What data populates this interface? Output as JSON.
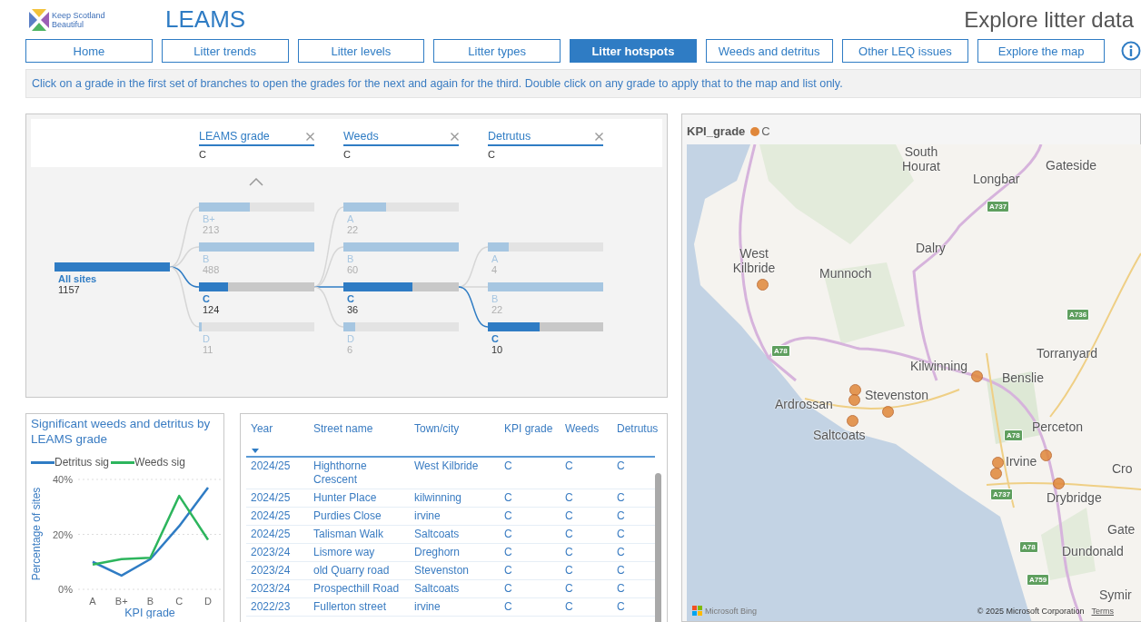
{
  "header": {
    "logo_text": "Keep Scotland Beautiful",
    "app_title": "LEAMS",
    "page_title": "Explore litter data"
  },
  "nav": [
    {
      "label": "Home",
      "selected": false
    },
    {
      "label": "Litter trends",
      "selected": false
    },
    {
      "label": "Litter levels",
      "selected": false
    },
    {
      "label": "Litter types",
      "selected": false
    },
    {
      "label": "Litter hotspots",
      "selected": true
    },
    {
      "label": "Weeds and detritus",
      "selected": false
    },
    {
      "label": "Other LEQ issues",
      "selected": false
    },
    {
      "label": "Explore the map",
      "selected": false
    }
  ],
  "instruction": "Click on a grade in the first set of branches to open the grades for the next and again for the third. Double click on any grade to apply that to the map and list only.",
  "decomposition_tree": {
    "filters": [
      {
        "label": "LEAMS grade",
        "value": "C"
      },
      {
        "label": "Weeds",
        "value": "C"
      },
      {
        "label": "Detrutus",
        "value": "C"
      }
    ],
    "root": {
      "label": "All sites",
      "count": "1157",
      "level": 1,
      "selected": true,
      "children": [
        {
          "label": "B+",
          "count": "213",
          "level": 0.44,
          "selected": false
        },
        {
          "label": "B",
          "count": "488",
          "level": 1,
          "selected": false
        },
        {
          "label": "C",
          "count": "124",
          "level": 0.25,
          "selected": true,
          "children": [
            {
              "label": "A",
              "count": "22",
              "level": 0.37,
              "selected": false
            },
            {
              "label": "B",
              "count": "60",
              "level": 1,
              "selected": false
            },
            {
              "label": "C",
              "count": "36",
              "level": 0.6,
              "selected": true,
              "children": [
                {
                  "label": "A",
                  "count": "4",
                  "level": 0.18,
                  "selected": false
                },
                {
                  "label": "B",
                  "count": "22",
                  "level": 1,
                  "selected": false
                },
                {
                  "label": "C",
                  "count": "10",
                  "level": 0.45,
                  "selected": true
                }
              ]
            },
            {
              "label": "D",
              "count": "6",
              "level": 0.1,
              "selected": false
            }
          ]
        },
        {
          "label": "D",
          "count": "11",
          "level": 0.02,
          "selected": false
        }
      ]
    }
  },
  "chart": {
    "title": "Significant weeds and detritus by LEAMS grade",
    "chart_data": {
      "type": "line",
      "xlabel": "KPI grade",
      "ylabel": "Percentage of sites",
      "categories": [
        "A",
        "B+",
        "B",
        "C",
        "D"
      ],
      "series": [
        {
          "name": "Detritus sig",
          "color": "#2f7cc4",
          "values": [
            10,
            5,
            11,
            23,
            37
          ]
        },
        {
          "name": "Weeds sig",
          "color": "#2db55d",
          "values": [
            9,
            11,
            11.5,
            34,
            18
          ]
        }
      ],
      "ylim": [
        0,
        40
      ],
      "yticks": [
        {
          "value": 0,
          "label": "0%"
        },
        {
          "value": 20,
          "label": "20%"
        },
        {
          "value": 40,
          "label": "40%"
        }
      ]
    }
  },
  "table": {
    "columns": [
      {
        "label": "Year",
        "sorted": true
      },
      {
        "label": "Street name",
        "sorted": false
      },
      {
        "label": "Town/city",
        "sorted": false
      },
      {
        "label": "KPI grade",
        "sorted": false
      },
      {
        "label": "Weeds",
        "sorted": false
      },
      {
        "label": "Detrutus",
        "sorted": false
      }
    ],
    "rows": [
      [
        "2024/25",
        "Highthorne Crescent",
        "West Kilbride",
        "C",
        "C",
        "C"
      ],
      [
        "2024/25",
        "Hunter Place",
        "kilwinning",
        "C",
        "C",
        "C"
      ],
      [
        "2024/25",
        "Purdies Close",
        "irvine",
        "C",
        "C",
        "C"
      ],
      [
        "2024/25",
        "Talisman Walk",
        "Saltcoats",
        "C",
        "C",
        "C"
      ],
      [
        "2023/24",
        "Lismore way",
        "Dreghorn",
        "C",
        "C",
        "C"
      ],
      [
        "2023/24",
        "old Quarry road",
        "Stevenston",
        "C",
        "C",
        "C"
      ],
      [
        "2023/24",
        "Prospecthill Road",
        "Saltcoats",
        "C",
        "C",
        "C"
      ],
      [
        "2022/23",
        "Fullerton street",
        "irvine",
        "C",
        "C",
        "C"
      ]
    ]
  },
  "map": {
    "legend_title": "KPI_grade",
    "legend_items": [
      {
        "label": "C",
        "color": "#e0873a"
      }
    ],
    "place_labels": [
      "South Hourat",
      "Gateside",
      "Longbar",
      "Dalry",
      "West Kilbride",
      "Munnoch",
      "Torranyard",
      "Kilwinning",
      "Benslie",
      "Ardrossan",
      "Stevenston",
      "Saltcoats",
      "Perceton",
      "Irvine",
      "Cro",
      "Drybridge",
      "Gate",
      "Dundonald",
      "Symir"
    ],
    "road_labels": [
      "A737",
      "A736",
      "A78",
      "A78",
      "A737",
      "A78",
      "A759"
    ],
    "provider": "Microsoft Bing",
    "attribution": "© 2025 Microsoft Corporation",
    "terms_link": "Terms"
  }
}
